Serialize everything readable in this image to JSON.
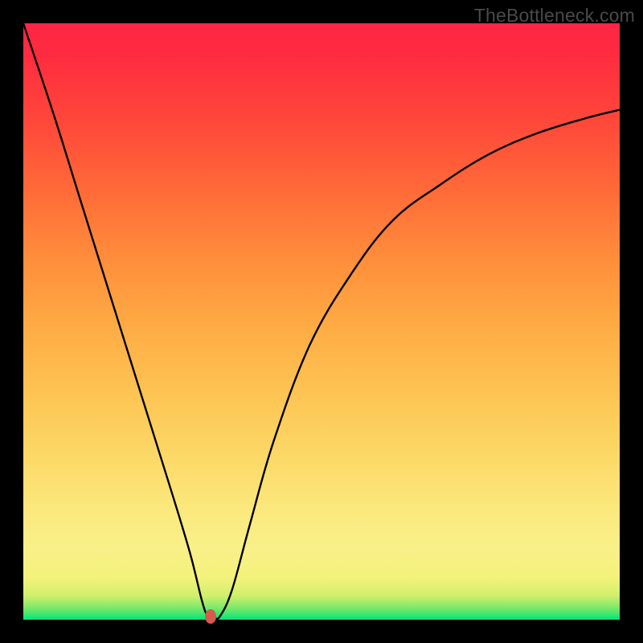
{
  "watermark": "TheBottleneck.com",
  "colors": {
    "frame": "#000000",
    "curve": "#000000",
    "marker": "#d65a4e",
    "gradient_top": "#ff2544",
    "gradient_bottom": "#00e676"
  },
  "chart_data": {
    "type": "line",
    "title": "",
    "xlabel": "",
    "ylabel": "",
    "xlim": [
      0,
      100
    ],
    "ylim": [
      0,
      100
    ],
    "grid": false,
    "legend": false,
    "series": [
      {
        "name": "bottleneck-curve",
        "x": [
          0,
          5,
          10,
          15,
          20,
          25,
          28,
          30,
          31,
          32,
          33,
          35,
          38,
          42,
          48,
          55,
          62,
          70,
          78,
          86,
          94,
          100
        ],
        "y": [
          100,
          85,
          69,
          53,
          37,
          21,
          11,
          3,
          0.5,
          0.3,
          0.6,
          5,
          16,
          30,
          46,
          58,
          67,
          73,
          78,
          81.5,
          84,
          85.5
        ]
      }
    ],
    "marker": {
      "x": 31.4,
      "y": 0.5
    },
    "annotations": []
  }
}
